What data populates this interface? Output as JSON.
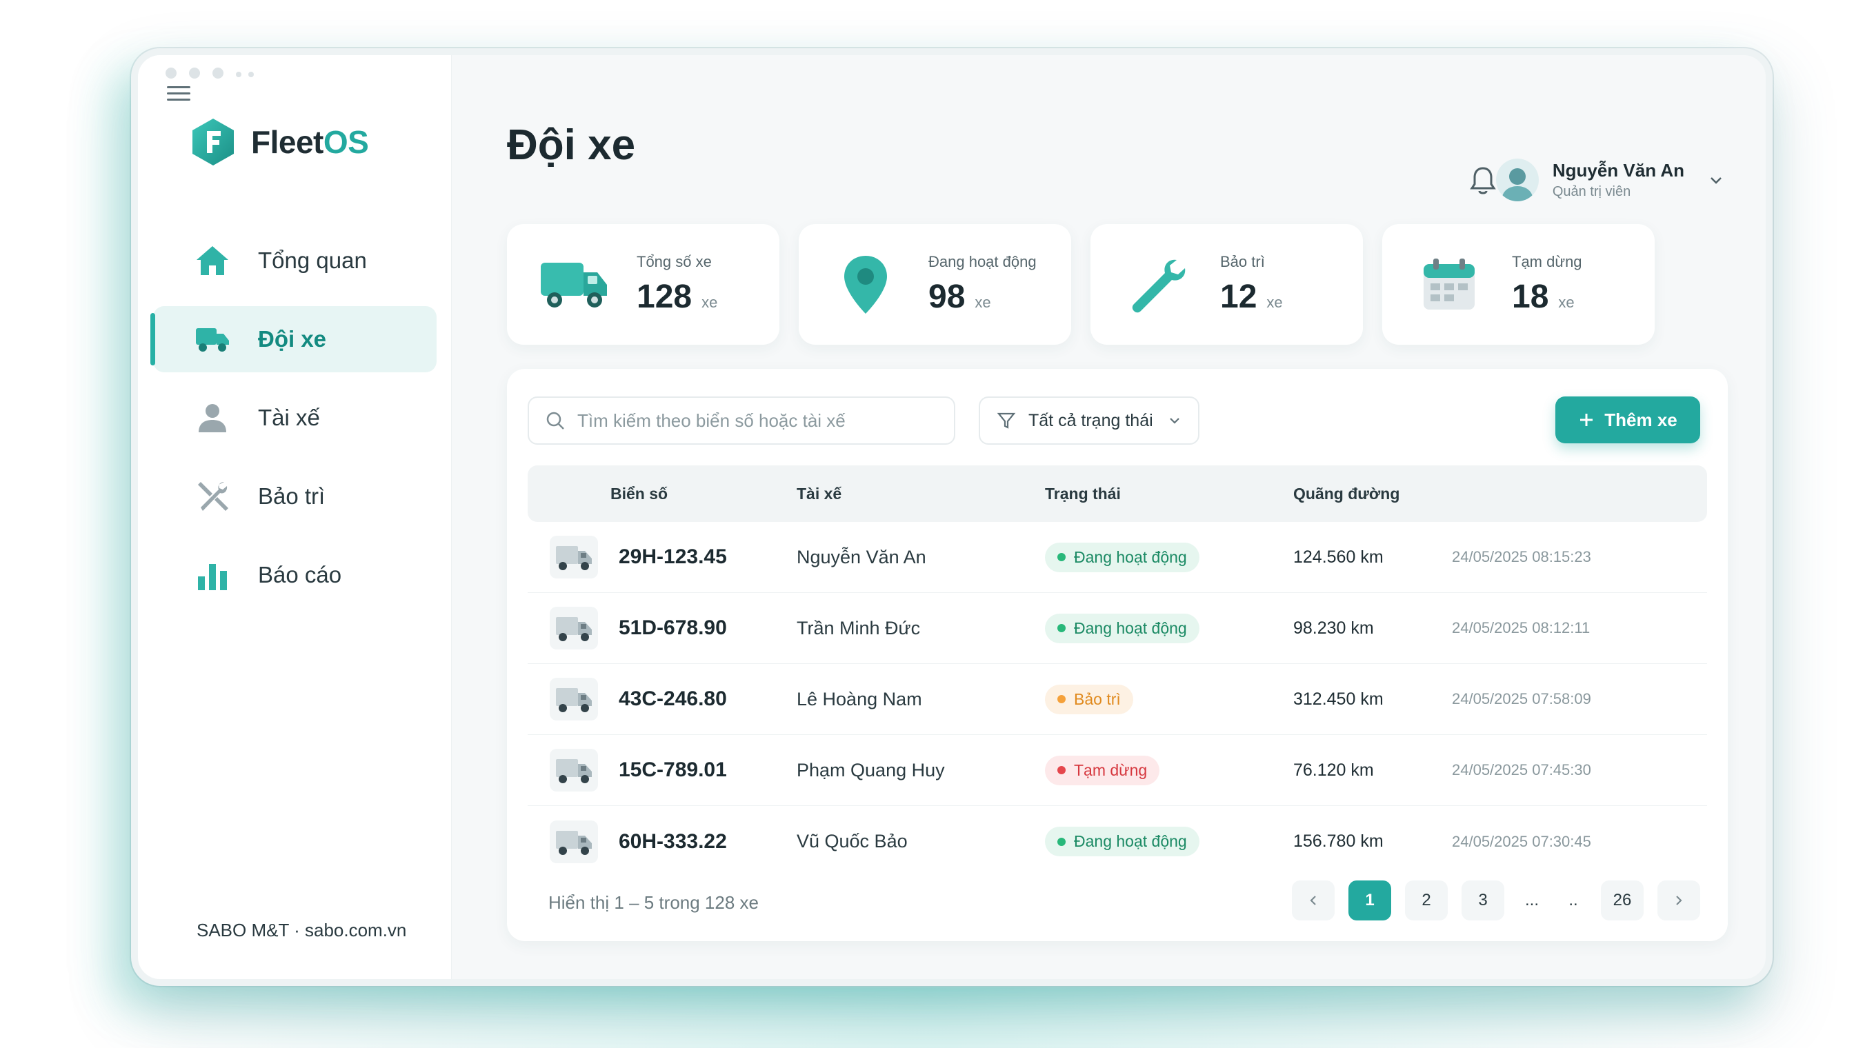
{
  "brand": {
    "name_main": "Fleet",
    "name_accent": "OS",
    "logo_letter": "F",
    "color": "#23a99f"
  },
  "sidebar": {
    "items": [
      {
        "label": "Tổng quan",
        "icon": "home-icon",
        "active": false
      },
      {
        "label": "Đội xe",
        "icon": "truck-icon",
        "active": true
      },
      {
        "label": "Tài xế",
        "icon": "user-icon",
        "active": false
      },
      {
        "label": "Bảo trì",
        "icon": "tools-icon",
        "active": false
      },
      {
        "label": "Báo cáo",
        "icon": "bar-chart-icon",
        "active": false
      }
    ],
    "footer": "SABO M&T · sabo.com.vn"
  },
  "header": {
    "title": "Đội xe",
    "user": {
      "name": "Nguyễn Văn An",
      "role": "Quản trị viên"
    }
  },
  "stats": [
    {
      "label": "Tổng số xe",
      "value": "128",
      "unit": "xe",
      "icon": "truck-icon"
    },
    {
      "label": "Đang hoạt động",
      "value": "98",
      "unit": "xe",
      "icon": "map-pin-icon"
    },
    {
      "label": "Bảo trì",
      "value": "12",
      "unit": "xe",
      "icon": "wrench-icon"
    },
    {
      "label": "Tạm dừng",
      "value": "18",
      "unit": "xe",
      "icon": "calendar-icon"
    }
  ],
  "toolbar": {
    "search_placeholder": "Tìm kiếm theo biển số hoặc tài xế",
    "filter_label": "Tất cả trạng thái",
    "add_label": "Thêm xe"
  },
  "table": {
    "headers": [
      "Biển số",
      "Tài xế",
      "Trạng thái",
      "Quãng đường",
      ""
    ],
    "rows": [
      {
        "plate": "29H-123.45",
        "driver": "Nguyễn Văn An",
        "status": "Đang hoạt động",
        "status_type": "ok",
        "distance": "124.560 km",
        "time": "24/05/2025 08:15:23"
      },
      {
        "plate": "51D-678.90",
        "driver": "Trần Minh Đức",
        "status": "Đang hoạt động",
        "status_type": "ok",
        "distance": "98.230 km",
        "time": "24/05/2025 08:12:11"
      },
      {
        "plate": "43C-246.80",
        "driver": "Lê Hoàng Nam",
        "status": "Bảo trì",
        "status_type": "warn",
        "distance": "312.450 km",
        "time": "24/05/2025 07:58:09"
      },
      {
        "plate": "15C-789.01",
        "driver": "Phạm Quang Huy",
        "status": "Tạm dừng",
        "status_type": "stop",
        "distance": "76.120 km",
        "time": "24/05/2025 07:45:30"
      },
      {
        "plate": "60H-333.22",
        "driver": "Vũ Quốc Bảo",
        "status": "Đang hoạt động",
        "status_type": "ok",
        "distance": "156.780 km",
        "time": "24/05/2025 07:30:45"
      }
    ]
  },
  "pagination": {
    "info": "Hiển thị 1 – 5 trong 128 xe",
    "pages": [
      "1",
      "2",
      "3",
      "...",
      "..",
      "26"
    ],
    "current": "1"
  }
}
